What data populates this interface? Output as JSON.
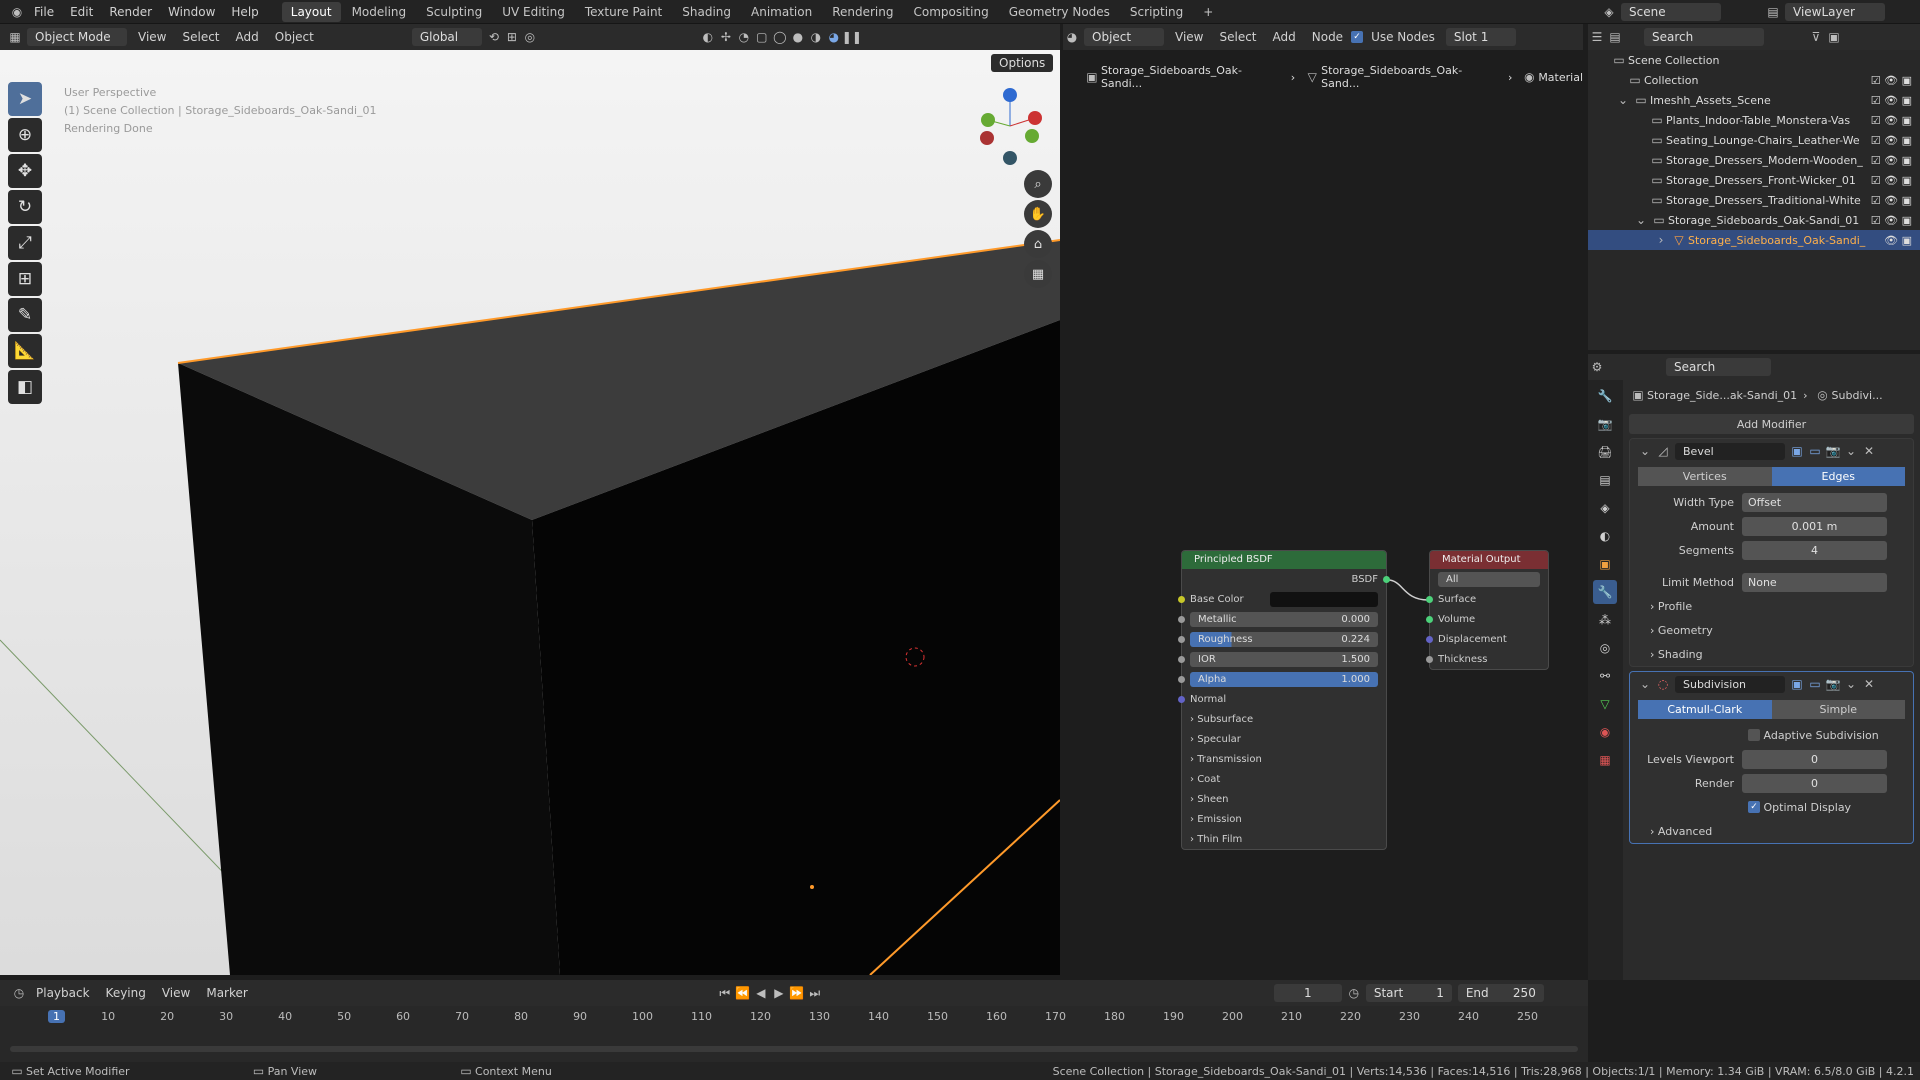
{
  "topbar": {
    "menus": [
      "File",
      "Edit",
      "Render",
      "Window",
      "Help"
    ],
    "workspaces": [
      "Layout",
      "Modeling",
      "Sculpting",
      "UV Editing",
      "Texture Paint",
      "Shading",
      "Animation",
      "Rendering",
      "Compositing",
      "Geometry Nodes",
      "Scripting"
    ],
    "active_workspace": "Layout",
    "scene": "Scene",
    "viewlayer": "ViewLayer"
  },
  "viewport": {
    "mode": "Object Mode",
    "menus": [
      "View",
      "Select",
      "Add",
      "Object"
    ],
    "orientation": "Global",
    "options_label": "Options",
    "overlay_lines": [
      "User Perspective",
      "(1) Scene Collection | Storage_Sideboards_Oak-Sandi_01",
      "Rendering Done"
    ]
  },
  "node_editor": {
    "type": "Object",
    "menus": [
      "View",
      "Select",
      "Add",
      "Node"
    ],
    "use_nodes": "Use Nodes",
    "slot": "Slot 1",
    "breadcrumb": [
      "Storage_Sideboards_Oak-Sandi...",
      "Storage_Sideboards_Oak-Sand...",
      "Material"
    ],
    "bsdf": {
      "title": "Principled BSDF",
      "output": "BSDF",
      "base_color": "Base Color",
      "fields": [
        {
          "label": "Metallic",
          "value": "0.000"
        },
        {
          "label": "Roughness",
          "value": "0.224"
        },
        {
          "label": "IOR",
          "value": "1.500"
        },
        {
          "label": "Alpha",
          "value": "1.000"
        }
      ],
      "normal": "Normal",
      "sections": [
        "Subsurface",
        "Specular",
        "Transmission",
        "Coat",
        "Sheen",
        "Emission",
        "Thin Film"
      ]
    },
    "output": {
      "title": "Material Output",
      "target": "All",
      "sockets": [
        "Surface",
        "Volume",
        "Displacement",
        "Thickness"
      ]
    }
  },
  "outliner": {
    "search_placeholder": "Search",
    "items": [
      "Scene Collection",
      "Collection",
      "Imeshh_Assets_Scene",
      "Plants_Indoor-Table_Monstera-Vas",
      "Seating_Lounge-Chairs_Leather-We",
      "Storage_Dressers_Modern-Wooden_",
      "Storage_Dressers_Front-Wicker_01",
      "Storage_Dressers_Traditional-White",
      "Storage_Sideboards_Oak-Sandi_01",
      "Storage_Sideboards_Oak-Sandi_"
    ]
  },
  "properties": {
    "search_placeholder": "Search",
    "breadcrumb_obj": "Storage_Side...ak-Sandi_01",
    "breadcrumb_mod": "Subdivi...",
    "add_modifier": "Add Modifier",
    "bevel": {
      "name": "Bevel",
      "tabs": [
        "Vertices",
        "Edges"
      ],
      "width_type_label": "Width Type",
      "width_type": "Offset",
      "amount_label": "Amount",
      "amount": "0.001 m",
      "segments_label": "Segments",
      "segments": "4",
      "limit_label": "Limit Method",
      "limit": "None",
      "panels": [
        "Profile",
        "Geometry",
        "Shading"
      ]
    },
    "subdivision": {
      "name": "Subdivision",
      "tabs": [
        "Catmull-Clark",
        "Simple"
      ],
      "adaptive": "Adaptive Subdivision",
      "levels_label": "Levels Viewport",
      "levels": "0",
      "render_label": "Render",
      "render": "0",
      "optimal": "Optimal Display",
      "advanced": "Advanced"
    }
  },
  "timeline": {
    "menus": [
      "Playback",
      "Keying",
      "View",
      "Marker"
    ],
    "frame": "1",
    "start_label": "Start",
    "start": "1",
    "end_label": "End",
    "end": "250",
    "ticks": [
      "1",
      "10",
      "20",
      "30",
      "40",
      "50",
      "60",
      "70",
      "80",
      "90",
      "100",
      "110",
      "120",
      "130",
      "140",
      "150",
      "160",
      "170",
      "180",
      "190",
      "200",
      "210",
      "220",
      "230",
      "240",
      "250"
    ]
  },
  "status": {
    "left": [
      "Set Active Modifier",
      "Pan View",
      "Context Menu"
    ],
    "right": "Scene Collection | Storage_Sideboards_Oak-Sandi_01 | Verts:14,536 | Faces:14,516 | Tris:28,968 | Objects:1/1 | Memory: 1.34 GiB | VRAM: 6.5/8.0 GiB | 4.2.1"
  },
  "colors": {
    "accent": "#4772b3",
    "selection": "#ff9a2a",
    "bsdf_header": "#2d6b3a",
    "output_header": "#7a2f33"
  }
}
